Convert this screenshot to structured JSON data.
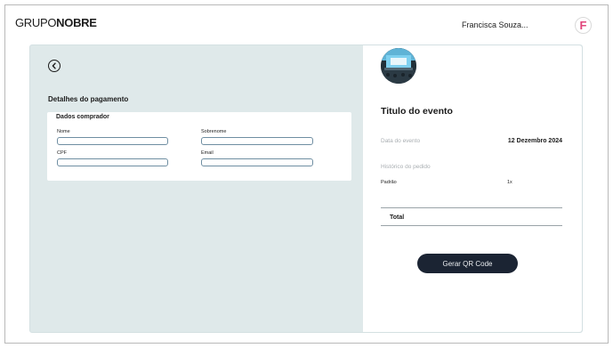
{
  "header": {
    "logo_light": "GRUPO",
    "logo_bold": "NOBRE",
    "user_name": "Francisca Souza...",
    "avatar_letter": "F"
  },
  "payment": {
    "title": "Detalhes do pagamento",
    "buyer_heading": "Dados comprador",
    "fields": {
      "nome": {
        "label": "Nome",
        "value": ""
      },
      "sobrenome": {
        "label": "Sobrenome",
        "value": ""
      },
      "cpf": {
        "label": "CPF",
        "value": ""
      },
      "email": {
        "label": "Email",
        "value": ""
      }
    }
  },
  "event": {
    "title": "Titulo do evento",
    "date_label": "Data do evento",
    "date_value": "12 Dezembro 2024",
    "history_label": "Histórico do pedido",
    "ticket_type": "Padrão",
    "ticket_qty": "1x",
    "total_label": "Total",
    "qr_button": "Gerar QR Code"
  },
  "colors": {
    "card_bg": "#dfe9ea",
    "button_bg": "#1b2433",
    "avatar_accent": "#e0457b"
  }
}
